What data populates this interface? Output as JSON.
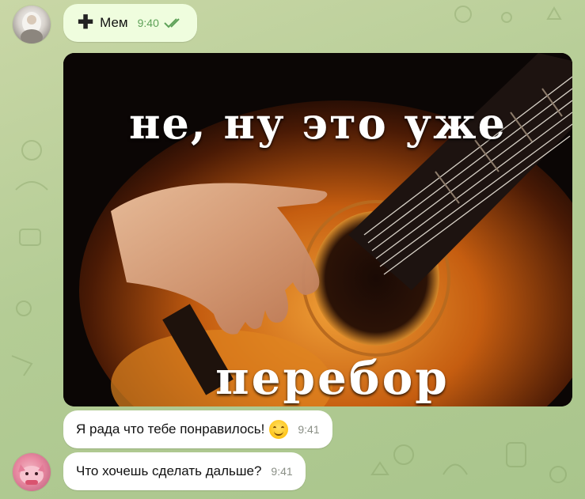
{
  "chat": {
    "top_message": {
      "icon": "plus-icon",
      "text": "Мем",
      "time": "9:40",
      "status": "read-checkmarks"
    },
    "photo": {
      "caption_top": "не, ну это уже",
      "caption_bottom": "перебор"
    },
    "messages": [
      {
        "text": "Я рада что тебе понравилось!",
        "emoji": "smiling-face-emoji",
        "time": "9:41"
      },
      {
        "text": "Что хочешь сделать дальше?",
        "time": "9:41"
      }
    ]
  },
  "colors": {
    "background": "#b4cc95",
    "outgoing_bubble": "#effdde",
    "incoming_bubble": "#ffffff",
    "read_check": "#5fa259"
  }
}
